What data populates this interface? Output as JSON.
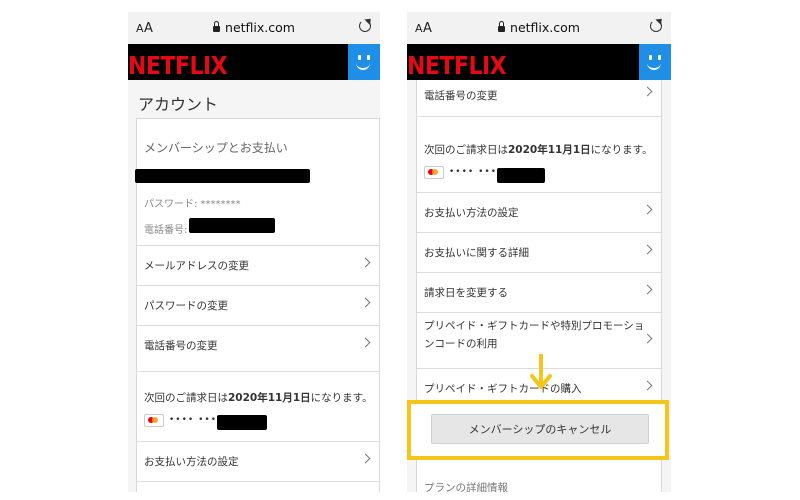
{
  "browser": {
    "aa_small": "A",
    "aa_big": "A",
    "url": "netflix.com",
    "icons": [
      "lock-icon",
      "reload-icon"
    ]
  },
  "brand": {
    "logo": "NETFLIX",
    "logo_color": "#e50914",
    "avatar_color": "#1e8ee6"
  },
  "left": {
    "page_title": "アカウント",
    "section_title": "メンバーシップとお支払い",
    "password_label": "パスワード: ********",
    "phone_label": "電話番号:",
    "rows": [
      {
        "label": "メールアドレスの変更"
      },
      {
        "label": "パスワードの変更"
      },
      {
        "label": "電話番号の変更"
      }
    ],
    "billing_prefix": "次回のご請求日は",
    "billing_date": "2020年11月1日",
    "billing_suffix": "になります。",
    "card_dots": "•••• •••• ••••",
    "payment_row": "お支払い方法の設定"
  },
  "right": {
    "top_row": "電話番号の変更",
    "billing_prefix": "次回のご請求日は",
    "billing_date": "2020年11月1日",
    "billing_suffix": "になります。",
    "card_dots": "•••• •••• ••••",
    "rows": [
      {
        "label": "お支払い方法の設定"
      },
      {
        "label": "お支払いに関する詳細"
      },
      {
        "label": "請求日を変更する"
      }
    ],
    "prepaid_line1": "プリペイド・ギフトカードや特別プロモーショ",
    "prepaid_line2": "ンコードの利用",
    "prepaid_purchase": "プリペイド・ギフトカードの購入",
    "cancel_button": "メンバーシップのキャンセル",
    "plan_peek": "プランの詳細情報",
    "highlight_color": "#f5c518"
  }
}
